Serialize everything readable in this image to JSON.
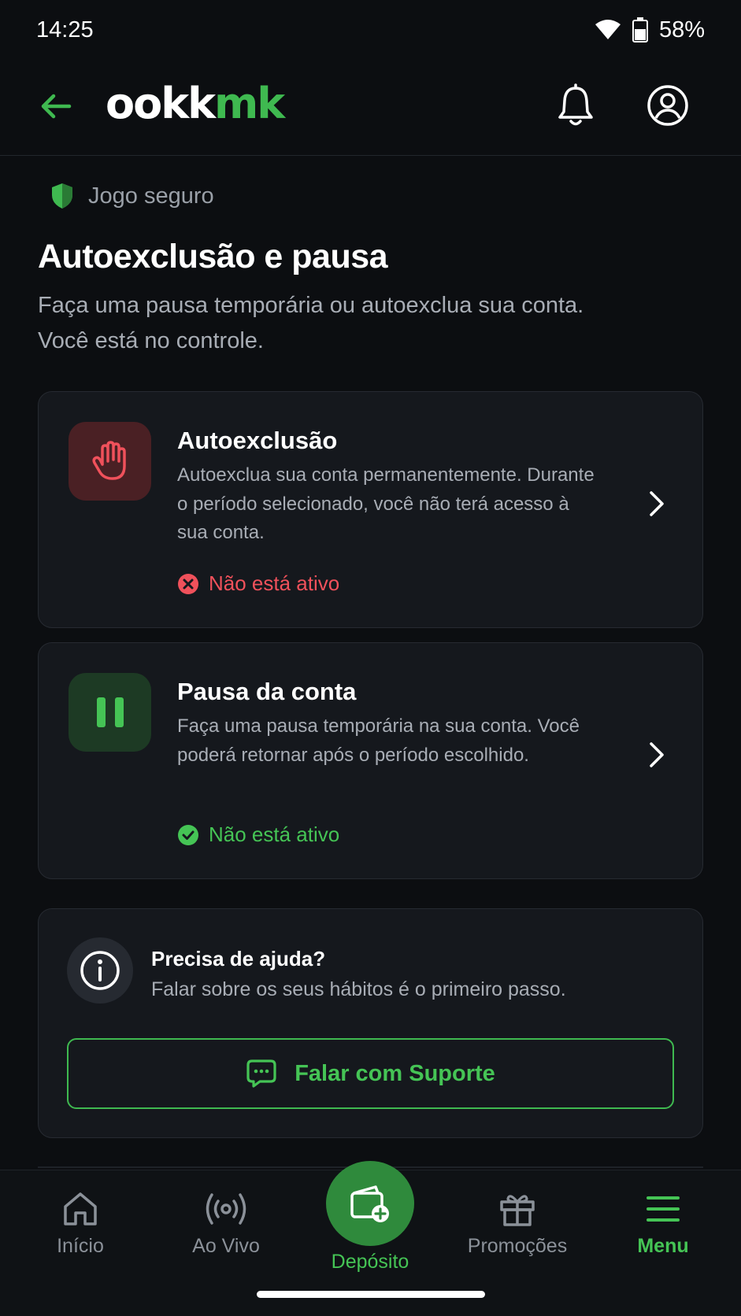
{
  "status_bar": {
    "time": "14:25",
    "battery": "58%"
  },
  "header": {
    "logo_part1": "ookk",
    "logo_part2": "mk"
  },
  "breadcrumb": {
    "label": "Jogo seguro"
  },
  "page": {
    "title": "Autoexclusão e pausa",
    "subtitle": "Faça uma pausa temporária ou autoexclua sua conta. Você está no controle."
  },
  "options": [
    {
      "title": "Autoexclusão",
      "description": "Autoexclua sua conta permanentemente. Durante o período selecionado, você não terá acesso à sua conta.",
      "status": "Não está ativo",
      "status_color": "#f0515b",
      "icon": "hand-stop-icon"
    },
    {
      "title": "Pausa da conta",
      "description": "Faça uma pausa temporária na sua conta. Você poderá retornar após o período escolhido.",
      "status": "Não está ativo",
      "status_color": "#45c455",
      "icon": "pause-icon"
    }
  ],
  "help": {
    "title": "Precisa de ajuda?",
    "text": "Falar sobre os seus hábitos é o primeiro passo.",
    "button_label": "Falar com Suporte"
  },
  "bottom_nav": [
    {
      "label": "Início",
      "icon": "home-icon"
    },
    {
      "label": "Ao Vivo",
      "icon": "live-broadcast-icon"
    },
    {
      "label": "Depósito",
      "icon": "wallet-add-icon"
    },
    {
      "label": "Promoções",
      "icon": "gift-icon"
    },
    {
      "label": "Menu",
      "icon": "menu-icon",
      "active": true
    }
  ],
  "colors": {
    "accent": "#3fb950",
    "danger": "#f0515b",
    "background": "#0c0e11"
  }
}
